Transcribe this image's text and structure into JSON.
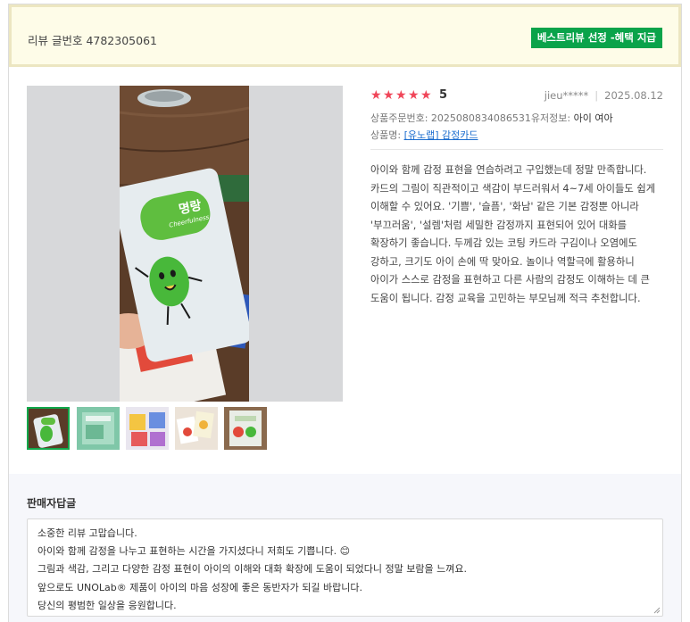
{
  "header": {
    "review_label": "리뷰 글번호 4782305061",
    "best_badge": "베스트리뷰 선정 -혜택 지급"
  },
  "review": {
    "rating": "5",
    "rating_value": 5,
    "user": "jieu*****",
    "date": "2025.08.12",
    "order_label": "상품주문번호: 2025080834086531",
    "user_info_label": "유저정보: ",
    "user_info_value": "아이 여아",
    "product_label": "상품명: ",
    "product_name": "[유노랩] 감정카드",
    "body": "아이와 함께 감정 표현을 연습하려고 구입했는데 정말 만족합니다. 카드의 그림이 직관적이고 색감이 부드러워서 4~7세 아이들도 쉽게 이해할 수 있어요. '기쁨', '슬픔', '화남' 같은 기본 감정뿐 아니라 '부끄러움', '설렘'처럼 세밀한 감정까지 표현되어 있어 대화를 확장하기 좋습니다. 두께감 있는 코팅 카드라 구김이나 오염에도 강하고, 크기도 아이 손에 딱 맞아요. 놀이나 역할극에 활용하니 아이가 스스로 감정을 표현하고 다른 사람의 감정도 이해하는 데 큰 도움이 됩니다. 감정 교육을 고민하는 부모님께 적극 추천합니다."
  },
  "photo": {
    "card_title": "명랑",
    "card_subtitle": "Cheerfulness"
  },
  "seller_reply": {
    "title": "판매자답글",
    "lines": [
      "소중한 리뷰 고맙습니다.",
      "아이와 함께 감정을 나누고 표현하는 시간을 가지셨다니 저희도 기쁩니다. 😊",
      "그림과 색감, 그리고 다양한 감정 표현이 아이의 이해와 대화 확장에 도움이 되었다니 정말 보람을 느껴요.",
      "앞으로도 UNOLab® 제품이 아이의 마음 성장에 좋은 동반자가 되길 바랍니다.",
      "당신의 평범한 일상을 응원합니다."
    ]
  },
  "colors": {
    "badge_green": "#0aa34a",
    "star_red": "#f04659",
    "link_blue": "#1a6ccf",
    "header_bg": "#fefce8"
  }
}
